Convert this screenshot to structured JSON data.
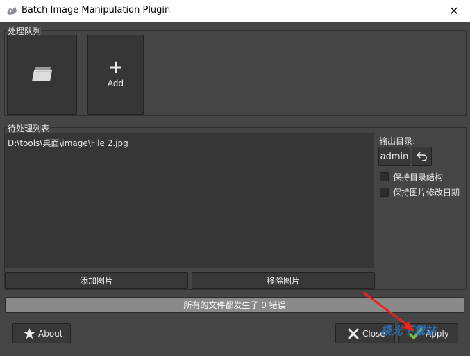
{
  "window": {
    "title": "Batch Image Manipulation Plugin",
    "close_glyph": "✕"
  },
  "queue": {
    "legend": "处理队列",
    "add_label": "Add",
    "add_glyph": "+"
  },
  "pending": {
    "legend": "待处理列表",
    "items": [
      "D:\\tools\\桌面\\image\\File 2.jpg"
    ],
    "add_images_label": "添加图片",
    "remove_images_label": "移除图片"
  },
  "output": {
    "label": "输出目录:",
    "folder_value": "admin",
    "keep_structure_label": "保持目录结构",
    "keep_date_label": "保持图片修改日期"
  },
  "status": {
    "message": "所有的文件都发生了 0 错误"
  },
  "footer": {
    "about_label": "About",
    "close_label": "Close",
    "apply_label": "Apply"
  },
  "watermark": {
    "text": "极光下载站"
  },
  "colors": {
    "background": "#454545",
    "panel": "#363636",
    "progress": "#8a8a8a",
    "arrow": "#e8231e",
    "apply_check": "#7cc242"
  }
}
